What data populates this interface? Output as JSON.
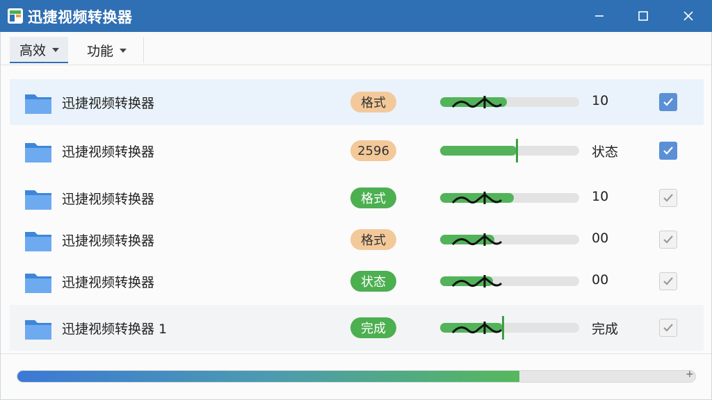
{
  "window": {
    "title": "迅捷视频转换器"
  },
  "toolbar": {
    "menu1": "高效",
    "menu2": "功能"
  },
  "files": [
    {
      "name": "迅捷视频转换器",
      "tag": "格式",
      "tag_style": "orange",
      "progress": 0.48,
      "value": "10",
      "checked": true,
      "selected": true
    },
    {
      "name": "迅捷视频转换器",
      "tag": "2596",
      "tag_style": "orange",
      "progress": 0.55,
      "value": "状态",
      "checked": true
    },
    {
      "name": "迅捷视频转换器",
      "tag": "格式",
      "tag_style": "green",
      "progress": 0.53,
      "value": "10",
      "checked": false
    },
    {
      "name": "迅捷视频转换器",
      "tag": "格式",
      "tag_style": "orange",
      "progress": 0.39,
      "value": "00",
      "checked": false
    },
    {
      "name": "迅捷视频转换器",
      "tag": "状态",
      "tag_style": "green",
      "progress": 0.38,
      "value": "00",
      "checked": false
    },
    {
      "name": "迅捷视频转换器 1",
      "tag": "完成",
      "tag_style": "green",
      "progress": 0.45,
      "value": "完成",
      "checked": false,
      "alt": true
    }
  ],
  "overall_progress": 0.74,
  "colors": {
    "accent": "#2f6fb3",
    "green": "#4caf50",
    "orange": "#f3c99a"
  }
}
